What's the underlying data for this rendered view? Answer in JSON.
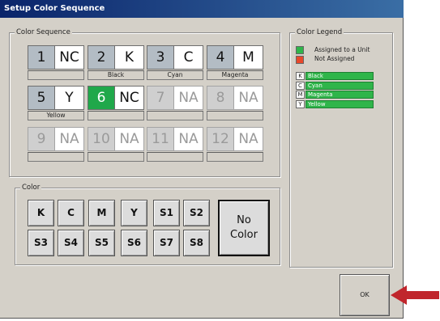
{
  "window": {
    "title": "Setup Color Sequence"
  },
  "sequence": {
    "title": "Color Sequence",
    "slots": [
      {
        "num": "1",
        "code": "NC",
        "name": "",
        "state": "assigned"
      },
      {
        "num": "2",
        "code": "K",
        "name": "Black",
        "state": "assigned"
      },
      {
        "num": "3",
        "code": "C",
        "name": "Cyan",
        "state": "assigned"
      },
      {
        "num": "4",
        "code": "M",
        "name": "Magenta",
        "state": "assigned"
      },
      {
        "num": "5",
        "code": "Y",
        "name": "Yellow",
        "state": "assigned"
      },
      {
        "num": "6",
        "code": "NC",
        "name": "",
        "state": "selected"
      },
      {
        "num": "7",
        "code": "NA",
        "name": "",
        "state": "disabled"
      },
      {
        "num": "8",
        "code": "NA",
        "name": "",
        "state": "disabled"
      },
      {
        "num": "9",
        "code": "NA",
        "name": "",
        "state": "disabled"
      },
      {
        "num": "10",
        "code": "NA",
        "name": "",
        "state": "disabled"
      },
      {
        "num": "11",
        "code": "NA",
        "name": "",
        "state": "disabled"
      },
      {
        "num": "12",
        "code": "NA",
        "name": "",
        "state": "disabled"
      }
    ]
  },
  "color": {
    "title": "Color",
    "buttons": [
      "K",
      "C",
      "M",
      "Y",
      "S1",
      "S2",
      "S3",
      "S4",
      "S5",
      "S6",
      "S7",
      "S8"
    ],
    "no_color_line1": "No",
    "no_color_line2": "Color"
  },
  "legend": {
    "title": "Color Legend",
    "assigned": "Assigned to a Unit",
    "not_assigned": "Not Assigned",
    "assigned_color": "#2fb54a",
    "not_assigned_color": "#e8482a",
    "entries": [
      {
        "key": "K",
        "name": "Black"
      },
      {
        "key": "C",
        "name": "Cyan"
      },
      {
        "key": "M",
        "name": "Magenta"
      },
      {
        "key": "Y",
        "name": "Yellow"
      }
    ]
  },
  "ok_label": "OK",
  "arrow_color": "#c0262c"
}
